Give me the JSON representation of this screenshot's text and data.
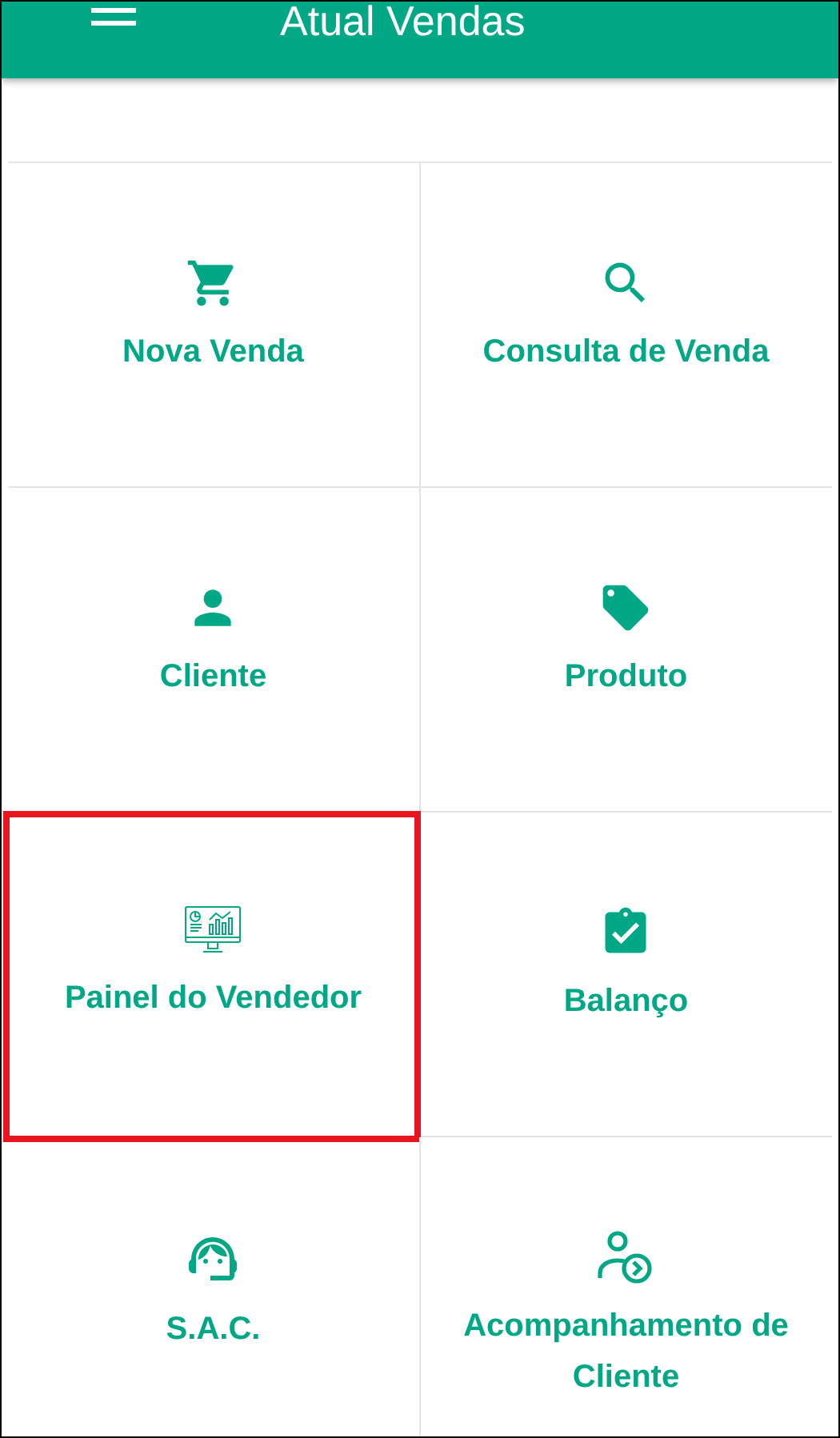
{
  "header": {
    "title": "Atual Vendas"
  },
  "tiles": [
    {
      "label": "Nova Venda",
      "kind": "cart",
      "highlighted": false
    },
    {
      "label": "Consulta de Venda",
      "kind": "search",
      "highlighted": false
    },
    {
      "label": "Cliente",
      "kind": "person",
      "highlighted": false
    },
    {
      "label": "Produto",
      "kind": "tag",
      "highlighted": false
    },
    {
      "label": "Painel do Vendedor",
      "kind": "dashboard",
      "highlighted": true
    },
    {
      "label": "Balanço",
      "kind": "clipboard",
      "highlighted": false
    },
    {
      "label": "S.A.C.",
      "kind": "agent",
      "highlighted": false
    },
    {
      "label": "Acompanhamento de Cliente",
      "kind": "follow",
      "highlighted": false
    }
  ]
}
